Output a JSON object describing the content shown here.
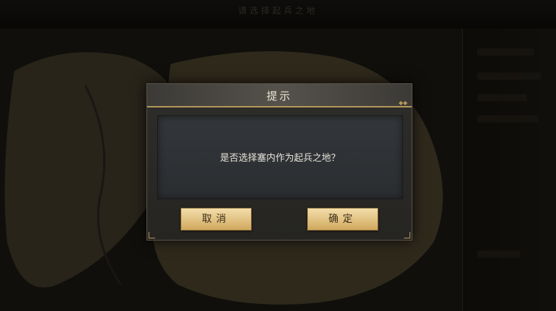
{
  "screen": {
    "top_title": "请选择起兵之地"
  },
  "dialog": {
    "title": "提示",
    "message": "是否选择塞内作为起兵之地？",
    "cancel_label": "取消",
    "confirm_label": "确定"
  },
  "map": {
    "labels": [
      "",
      "",
      "",
      "",
      ""
    ]
  },
  "colors": {
    "dialog_bg": "#2e2d2a",
    "header_border": "#b5985a",
    "button_gold": "#e3c485",
    "button_text": "#3a2c18"
  }
}
